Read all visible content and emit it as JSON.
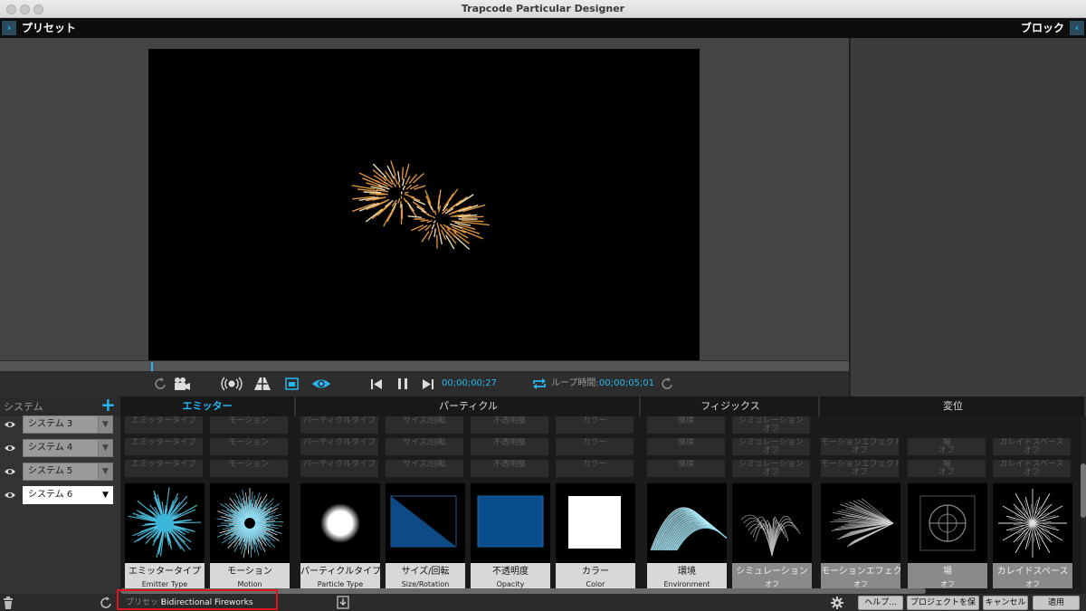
{
  "window": {
    "title": "Trapcode Particular Designer"
  },
  "topbar": {
    "presets_label": "プリセット",
    "blocks_label": "ブロック"
  },
  "transport": {
    "timecode": "00;00;00;27",
    "loop_label": "ループ時間:",
    "loop_time": "00;00;05;01"
  },
  "systems": {
    "header": "システム",
    "items": [
      {
        "name": "システム 3",
        "active": false
      },
      {
        "name": "システム 4",
        "active": false
      },
      {
        "name": "システム 5",
        "active": false
      },
      {
        "name": "システム 6",
        "active": true
      }
    ]
  },
  "categories": [
    {
      "label": "エミッター",
      "active": true
    },
    {
      "label": "パーティクル",
      "active": false
    },
    {
      "label": "フィジックス",
      "active": false
    },
    {
      "label": "変位",
      "active": false
    }
  ],
  "ghost_rows": {
    "row1": [
      "エミッタータイプ",
      "モーション",
      "パーティクルタイプ",
      "サイズ/回転",
      "不透明度",
      "カラー",
      "環境",
      "シミュレーション\nオフ"
    ],
    "row2": [
      "エミッタータイプ",
      "モーション",
      "パーティクルタイプ",
      "サイズ/回転",
      "不透明度",
      "カラー",
      "環境",
      "シミュレーション\nオフ",
      "モーションエフェクト\nオフ",
      "場\nオフ",
      "カレイドスペース\nオフ"
    ],
    "row3": [
      "エミッタータイプ",
      "モーション",
      "パーティクルタイプ",
      "サイズ/回転",
      "不透明度",
      "カラー",
      "環境",
      "シミュレーション\nオフ",
      "モーションエフェクト\nオフ",
      "場\nオフ",
      "カレイドスペース\nオフ"
    ]
  },
  "cards": [
    {
      "jp": "エミッタータイプ",
      "en": "Emitter Type",
      "dim": false,
      "thumb": "burst-cyan"
    },
    {
      "jp": "モーション",
      "en": "Motion",
      "dim": false,
      "thumb": "radial-cyan"
    },
    {
      "jp": "パーティクルタイプ",
      "en": "Particle Type",
      "dim": false,
      "thumb": "soft-sphere"
    },
    {
      "jp": "サイズ/回転",
      "en": "Size/Rotation",
      "dim": false,
      "thumb": "triangle-blue"
    },
    {
      "jp": "不透明度",
      "en": "Opacity",
      "dim": false,
      "thumb": "square-blue"
    },
    {
      "jp": "カラー",
      "en": "Color",
      "dim": false,
      "thumb": "square-white"
    },
    {
      "jp": "環境",
      "en": "Environment",
      "dim": false,
      "thumb": "arc-cyan"
    },
    {
      "jp": "シミュレーション",
      "en": "オフ",
      "dim": true,
      "thumb": "fountain-gray"
    },
    {
      "jp": "モーションエフェク",
      "en": "オフ",
      "dim": true,
      "thumb": "fan-gray"
    },
    {
      "jp": "場",
      "en": "オフ",
      "dim": true,
      "thumb": "target-gray"
    },
    {
      "jp": "カレイドスペース",
      "en": "オフ",
      "dim": true,
      "thumb": "star-gray"
    }
  ],
  "bottombar": {
    "preset_prefix": "プリセット",
    "preset_name": "Bidirectional Fireworks",
    "help": "ヘルプ...",
    "save_project": "プロジェクトを保存",
    "cancel": "キャンセル",
    "apply": "適用"
  },
  "colors": {
    "accent": "#27b7f0",
    "firework": "#f0a040",
    "highlight": "#e0161e"
  }
}
